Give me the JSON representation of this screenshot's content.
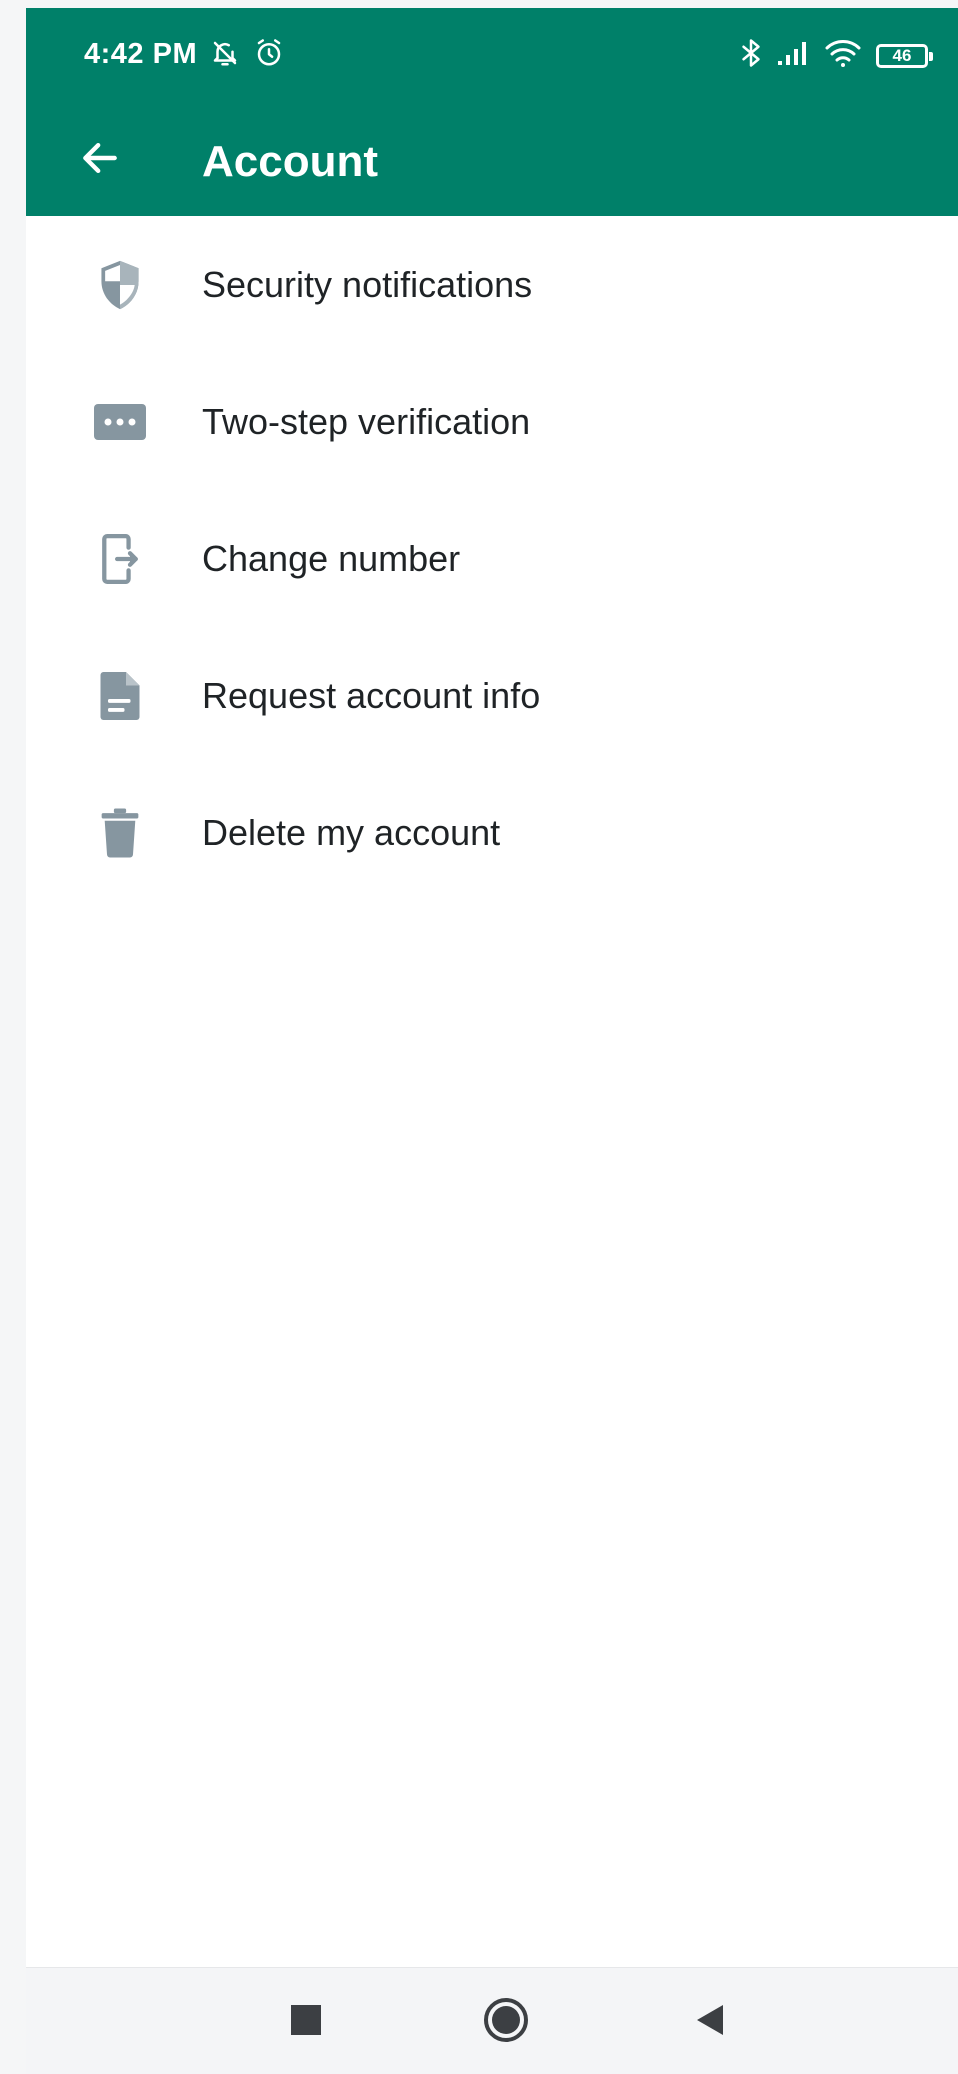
{
  "status_bar": {
    "time": "4:42 PM",
    "battery_level": "46",
    "icons": [
      "mute-icon",
      "alarm-icon",
      "bluetooth-icon",
      "signal-icon",
      "wifi-icon",
      "battery-icon"
    ]
  },
  "app_bar": {
    "title": "Account",
    "back_icon": "arrow-left-icon"
  },
  "settings": {
    "items": [
      {
        "label": "Security notifications",
        "icon": "shield-icon"
      },
      {
        "label": "Two-step verification",
        "icon": "password-dots-icon"
      },
      {
        "label": "Change number",
        "icon": "change-number-icon"
      },
      {
        "label": "Request account info",
        "icon": "document-icon"
      },
      {
        "label": "Delete my account",
        "icon": "trash-icon"
      }
    ]
  },
  "nav_bar": {
    "buttons": [
      "recents-button",
      "home-button",
      "back-button"
    ]
  },
  "colors": {
    "header_bg": "#008069",
    "icon_gray": "#8696a0",
    "text_primary": "#1f2326",
    "nav_bg": "#f4f5f7"
  }
}
